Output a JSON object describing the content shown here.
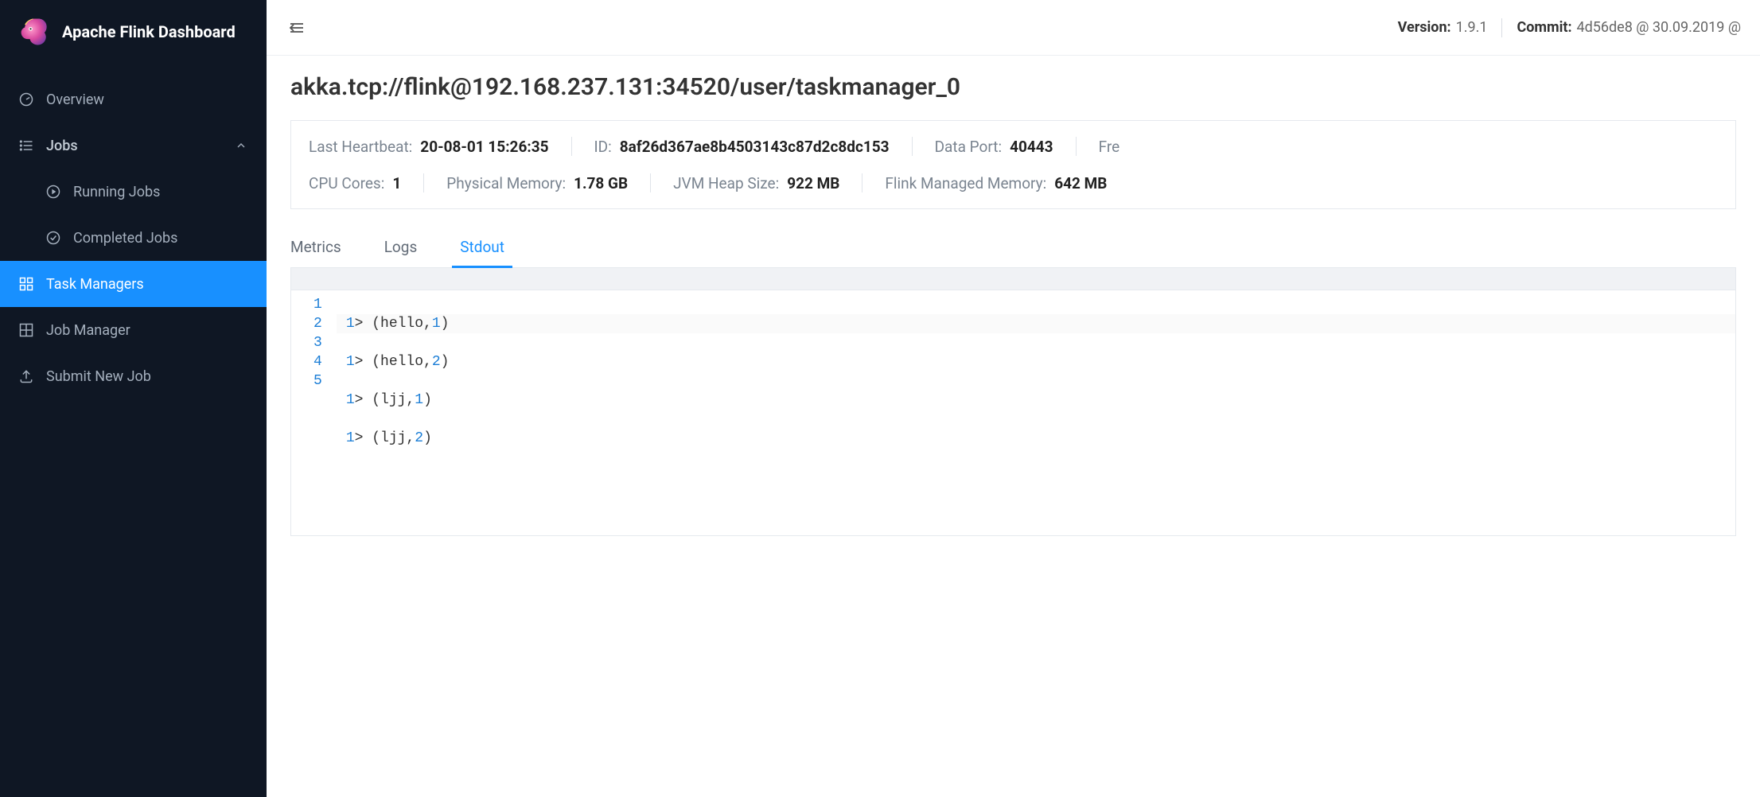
{
  "app_title": "Apache Flink Dashboard",
  "topbar": {
    "version_label": "Version:",
    "version_value": "1.9.1",
    "commit_label": "Commit:",
    "commit_value": "4d56de8 @ 30.09.2019 @"
  },
  "sidebar": {
    "items": [
      {
        "label": "Overview",
        "icon": "gauge-icon"
      },
      {
        "label": "Jobs",
        "icon": "list-icon",
        "expandable": true
      },
      {
        "label": "Running Jobs",
        "icon": "play-circle-icon",
        "sub": true
      },
      {
        "label": "Completed Jobs",
        "icon": "check-circle-icon",
        "sub": true
      },
      {
        "label": "Task Managers",
        "icon": "cluster-icon",
        "active": true
      },
      {
        "label": "Job Manager",
        "icon": "grid-icon"
      },
      {
        "label": "Submit New Job",
        "icon": "upload-icon"
      }
    ]
  },
  "page_title": "akka.tcp://flink@192.168.237.131:34520/user/taskmanager_0",
  "info": {
    "row1": [
      {
        "label": "Last Heartbeat:",
        "value": "20-08-01 15:26:35"
      },
      {
        "label": "ID:",
        "value": "8af26d367ae8b4503143c87d2c8dc153"
      },
      {
        "label": "Data Port:",
        "value": "40443"
      },
      {
        "label": "Fre",
        "value": ""
      }
    ],
    "row2": [
      {
        "label": "CPU Cores:",
        "value": "1"
      },
      {
        "label": "Physical Memory:",
        "value": "1.78 GB"
      },
      {
        "label": "JVM Heap Size:",
        "value": "922 MB"
      },
      {
        "label": "Flink Managed Memory:",
        "value": "642 MB"
      }
    ]
  },
  "tabs": [
    {
      "label": "Metrics",
      "active": false
    },
    {
      "label": "Logs",
      "active": false
    },
    {
      "label": "Stdout",
      "active": true
    }
  ],
  "stdout": {
    "lines": [
      {
        "n": "1",
        "prefix_num": "1",
        "prefix_rest": "> (hello,",
        "val_num": "1",
        "suffix": ")"
      },
      {
        "n": "2",
        "prefix_num": "1",
        "prefix_rest": "> (hello,",
        "val_num": "2",
        "suffix": ")"
      },
      {
        "n": "3",
        "prefix_num": "1",
        "prefix_rest": "> (ljj,",
        "val_num": "1",
        "suffix": ")"
      },
      {
        "n": "4",
        "prefix_num": "1",
        "prefix_rest": "> (ljj,",
        "val_num": "2",
        "suffix": ")"
      },
      {
        "n": "5",
        "prefix_num": "",
        "prefix_rest": "",
        "val_num": "",
        "suffix": ""
      }
    ]
  }
}
